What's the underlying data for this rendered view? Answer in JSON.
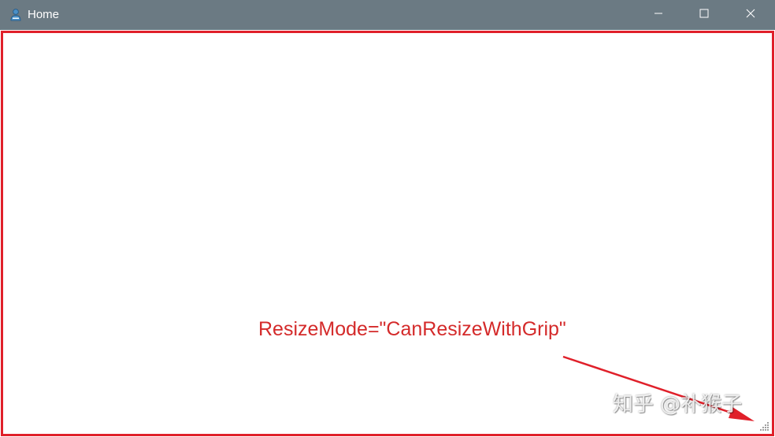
{
  "window": {
    "title": "Home",
    "app_icon": "person-icon",
    "titlebar_color": "#6b7a83"
  },
  "caption_buttons": {
    "minimize_icon": "minimize-icon",
    "maximize_icon": "maximize-icon",
    "close_icon": "close-icon"
  },
  "annotation": {
    "text": "ResizeMode=\"CanResizeWithGrip\"",
    "color": "#d42a2a",
    "frame_color": "#e0202a"
  },
  "watermark": {
    "text": "知乎 @补猴子"
  },
  "resize_grip": {
    "icon": "resize-grip-icon"
  }
}
